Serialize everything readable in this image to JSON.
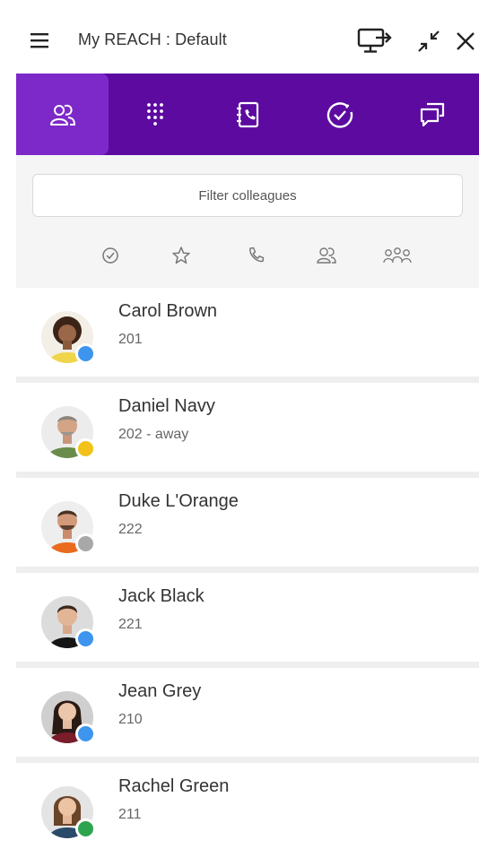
{
  "window": {
    "title": "My REACH : Default",
    "icons": {
      "menu": "hamburger-icon",
      "monitor": "monitor-share-icon",
      "collapse": "collapse-icon",
      "close": "close-icon"
    }
  },
  "tabs": [
    {
      "id": "colleagues",
      "icon": "colleagues-icon",
      "active": true
    },
    {
      "id": "dialpad",
      "icon": "dialpad-icon",
      "active": false
    },
    {
      "id": "contacts",
      "icon": "address-book-icon",
      "active": false
    },
    {
      "id": "status",
      "icon": "status-check-icon",
      "active": false
    },
    {
      "id": "chat",
      "icon": "chat-icon",
      "active": false
    }
  ],
  "filter": {
    "placeholder": "Filter colleagues",
    "chips": [
      "available-filter-icon",
      "favorites-filter-icon",
      "on-call-filter-icon",
      "group-filter-icon",
      "all-groups-filter-icon"
    ]
  },
  "colors": {
    "brand": "#5c0aa0",
    "brand_active": "#7d28c8",
    "status_available": "#3d95ee",
    "status_away": "#f2c21b",
    "status_offline": "#a8a8a8",
    "status_online": "#2ea44f"
  },
  "contacts": [
    {
      "name": "Carol Brown",
      "ext": "201",
      "status": "available"
    },
    {
      "name": "Daniel Navy",
      "ext": "202  - away",
      "status": "away"
    },
    {
      "name": "Duke L'Orange",
      "ext": "222",
      "status": "offline"
    },
    {
      "name": "Jack Black",
      "ext": "221",
      "status": "available"
    },
    {
      "name": "Jean Grey",
      "ext": "210",
      "status": "available"
    },
    {
      "name": "Rachel Green",
      "ext": "211",
      "status": "online"
    }
  ]
}
